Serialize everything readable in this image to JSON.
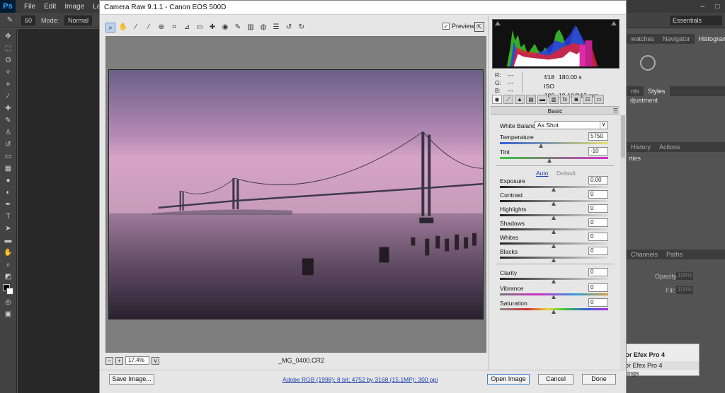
{
  "photoshop": {
    "menus": [
      "File",
      "Edit",
      "Image",
      "Layer"
    ],
    "options": {
      "brush_size": "60",
      "mode_label": "Mode:",
      "mode_value": "Normal"
    },
    "workspace": "Essentials",
    "panels": {
      "top_tabs": [
        "watches",
        "Navigator",
        "Histogram"
      ],
      "adj_tabs": [
        "nts",
        "Styles"
      ],
      "adj_title": "djustment",
      "history_tabs": [
        "History",
        "Actions"
      ],
      "props_title": "rties",
      "layers_tabs": [
        "Channels",
        "Paths"
      ],
      "opacity_label": "Opacity:",
      "opacity_value": "100%",
      "fill_label": "Fill:",
      "fill_value": "100%"
    },
    "efex": {
      "title": "lor Efex Pro 4",
      "line1": "lor Efex Pro 4",
      "line2": "ttings"
    }
  },
  "camera_raw": {
    "title": "Camera Raw 9.1.1  -  Canon EOS 500D",
    "preview_label": "Preview",
    "filename": "_MG_0400.CR2",
    "zoom": "17.4%",
    "workflow_link": "Adobe RGB (1998); 8 bit; 4752 by 3168 (15.1MP); 300 ppi",
    "buttons": {
      "save": "Save Image...",
      "open": "Open Image",
      "cancel": "Cancel",
      "done": "Done"
    },
    "readout": {
      "r_label": "R:",
      "g_label": "G:",
      "b_label": "B:",
      "r": "---",
      "g": "---",
      "b": "---",
      "aperture": "f/18",
      "shutter": "180.00 s",
      "iso": "ISO 100",
      "lens": "10-18@13 mm"
    },
    "panel_title": "Basic",
    "white_balance": {
      "label": "White Balance:",
      "value": "As Shot"
    },
    "auto_label": "Auto",
    "default_label": "Default",
    "sliders": [
      {
        "label": "Temperature",
        "value": "5750",
        "pos": 0.38
      },
      {
        "label": "Tint",
        "value": "-10",
        "pos": 0.46
      },
      {
        "label": "Exposure",
        "value": "0.00",
        "pos": 0.5
      },
      {
        "label": "Contrast",
        "value": "0",
        "pos": 0.5
      },
      {
        "label": "Highlights",
        "value": "0",
        "pos": 0.5
      },
      {
        "label": "Shadows",
        "value": "0",
        "pos": 0.5
      },
      {
        "label": "Whites",
        "value": "0",
        "pos": 0.5
      },
      {
        "label": "Blacks",
        "value": "0",
        "pos": 0.5
      },
      {
        "label": "Clarity",
        "value": "0",
        "pos": 0.5
      },
      {
        "label": "Vibrance",
        "value": "0",
        "pos": 0.5
      },
      {
        "label": "Saturation",
        "value": "0",
        "pos": 0.5
      }
    ]
  }
}
